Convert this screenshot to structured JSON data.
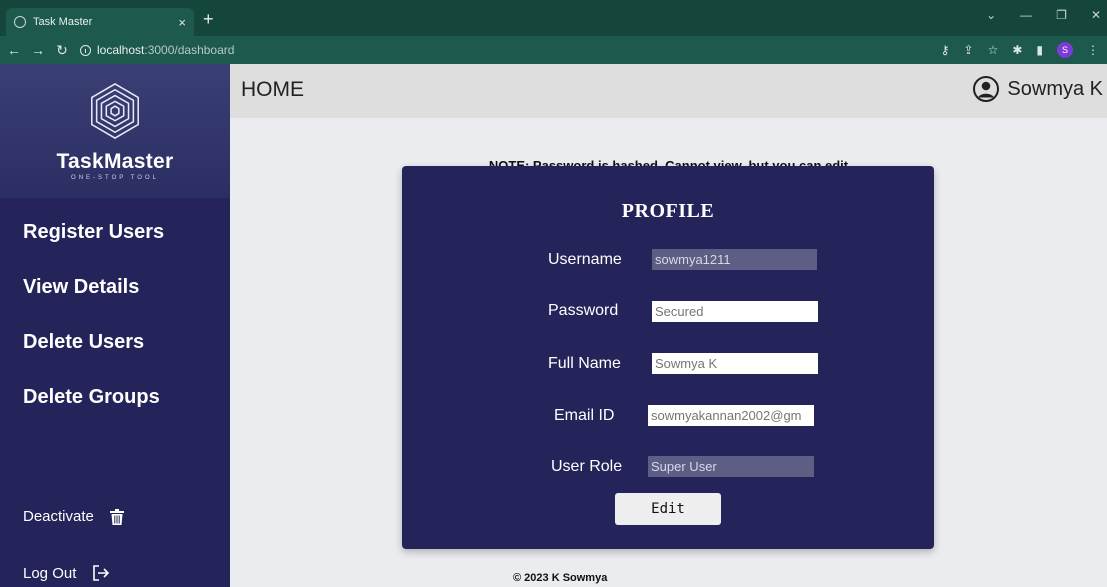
{
  "browser": {
    "tab_title": "Task Master",
    "tab_close": "×",
    "new_tab": "+",
    "url_host": "localhost",
    "url_rest": ":3000/dashboard",
    "profile_initial": "S"
  },
  "sidebar": {
    "brand_name": "TaskMaster",
    "brand_tagline": "ONE-STOP TOOL",
    "menu": [
      {
        "label": "Register Users"
      },
      {
        "label": "View Details"
      },
      {
        "label": "Delete Users"
      },
      {
        "label": "Delete Groups"
      }
    ],
    "deactivate_label": "Deactivate",
    "logout_label": "Log Out"
  },
  "header": {
    "title": "HOME",
    "user_name": "Sowmya K"
  },
  "note": "NOTE: Password is hashed. Cannot view, but you can edit",
  "profile": {
    "title": "PROFILE",
    "username_label": "Username",
    "username_value": "sowmya1211",
    "password_label": "Password",
    "password_placeholder": "Secured",
    "fullname_label": "Full Name",
    "fullname_value": "Sowmya K",
    "email_label": "Email ID",
    "email_value": "sowmyakannan2002@gm",
    "role_label": "User Role",
    "role_value": "Super User",
    "edit_label": "Edit"
  },
  "footer": "© 2023 K Sowmya"
}
